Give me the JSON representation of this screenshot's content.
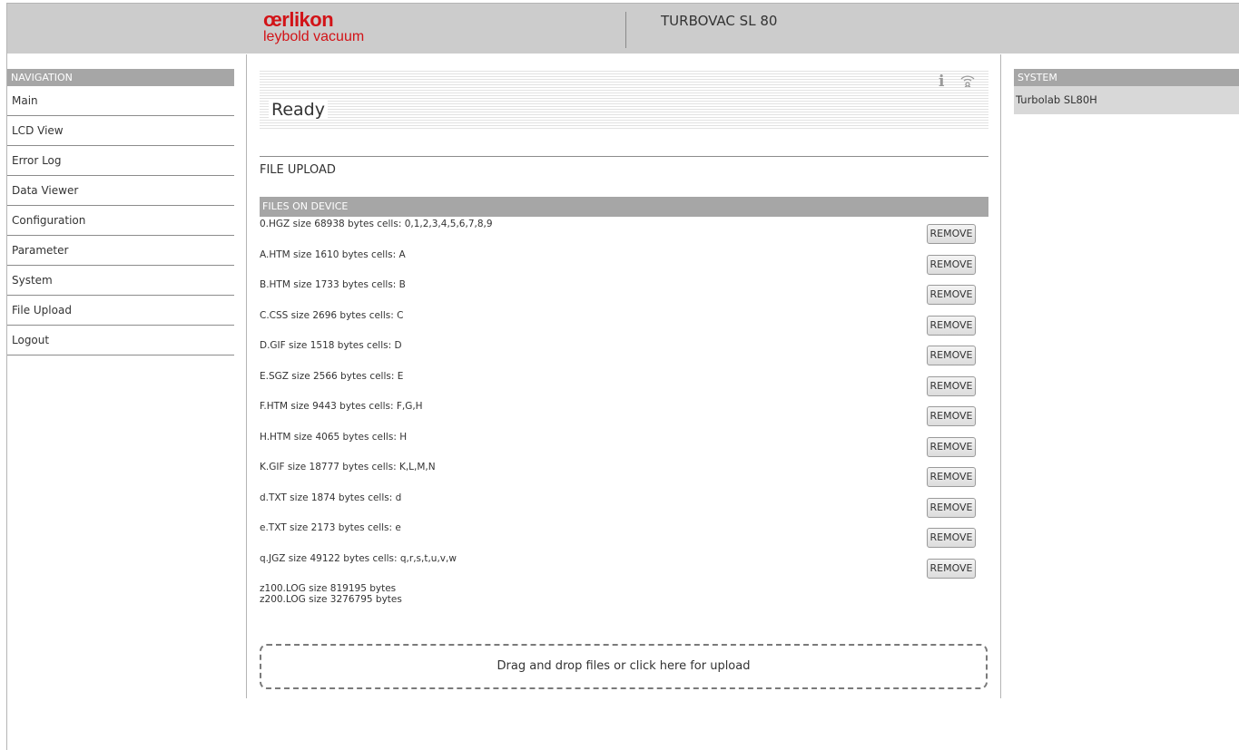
{
  "header": {
    "logo_top": "œrlikon",
    "logo_bottom": "leybold vacuum",
    "device_title": "TURBOVAC SL 80"
  },
  "navigation": {
    "heading": "NAVIGATION",
    "items": [
      "Main",
      "LCD View",
      "Error Log",
      "Data Viewer",
      "Configuration",
      "Parameter",
      "System",
      "File Upload",
      "Logout"
    ]
  },
  "status": {
    "text": "Ready",
    "info_icon": "info-icon",
    "signal_icon": "wifi-signal-icon"
  },
  "file_upload": {
    "title": "FILE UPLOAD",
    "files_heading": "FILES ON DEVICE",
    "remove_label": "REMOVE",
    "files": [
      "0.HGZ size 68938 bytes cells: 0,1,2,3,4,5,6,7,8,9",
      "A.HTM size 1610 bytes cells: A",
      "B.HTM size 1733 bytes cells: B",
      "C.CSS size 2696 bytes cells: C",
      "D.GIF size 1518 bytes cells: D",
      "E.SGZ size 2566 bytes cells: E",
      "F.HTM size 9443 bytes cells: F,G,H",
      "H.HTM size 4065 bytes cells: H",
      "K.GIF size 18777 bytes cells: K,L,M,N",
      "d.TXT size 1874 bytes cells: d",
      "e.TXT size 2173 bytes cells: e",
      "q.JGZ size 49122 bytes cells: q,r,s,t,u,v,w"
    ],
    "logs": [
      "z100.LOG size 819195 bytes",
      "z200.LOG size 3276795 bytes"
    ],
    "dropzone_text": "Drag and drop files or click here for upload"
  },
  "system": {
    "heading": "SYSTEM",
    "items": [
      "Turbolab SL80H"
    ]
  },
  "colors": {
    "brand": "#d21317",
    "header_bg": "#cccccc",
    "panel_head_bg": "#a6a6a6"
  }
}
